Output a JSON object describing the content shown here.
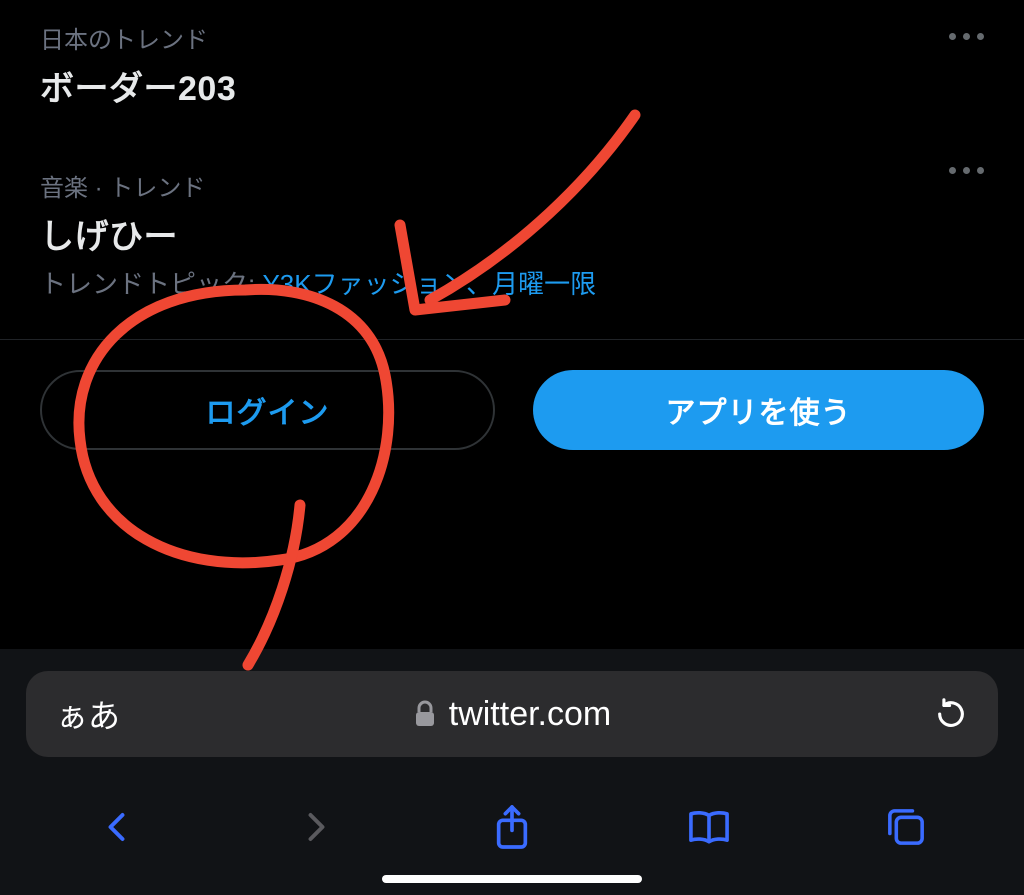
{
  "trends": [
    {
      "category": "日本のトレンド",
      "title": "ボーダー203"
    },
    {
      "category": "音楽 · トレンド",
      "title": "しげひー",
      "topics_prefix": "トレンドトピック:",
      "topics": [
        "Y3Kファッション",
        "月曜一限"
      ],
      "topics_separator": "、"
    }
  ],
  "buttons": {
    "login": "ログイン",
    "use_app": "アプリを使う"
  },
  "browser": {
    "aa": "ぁあ",
    "url": "twitter.com"
  },
  "colors": {
    "link": "#1d9bf0",
    "outline": "#2f3336",
    "muted": "#6b7280",
    "annotation": "#ef4733"
  }
}
